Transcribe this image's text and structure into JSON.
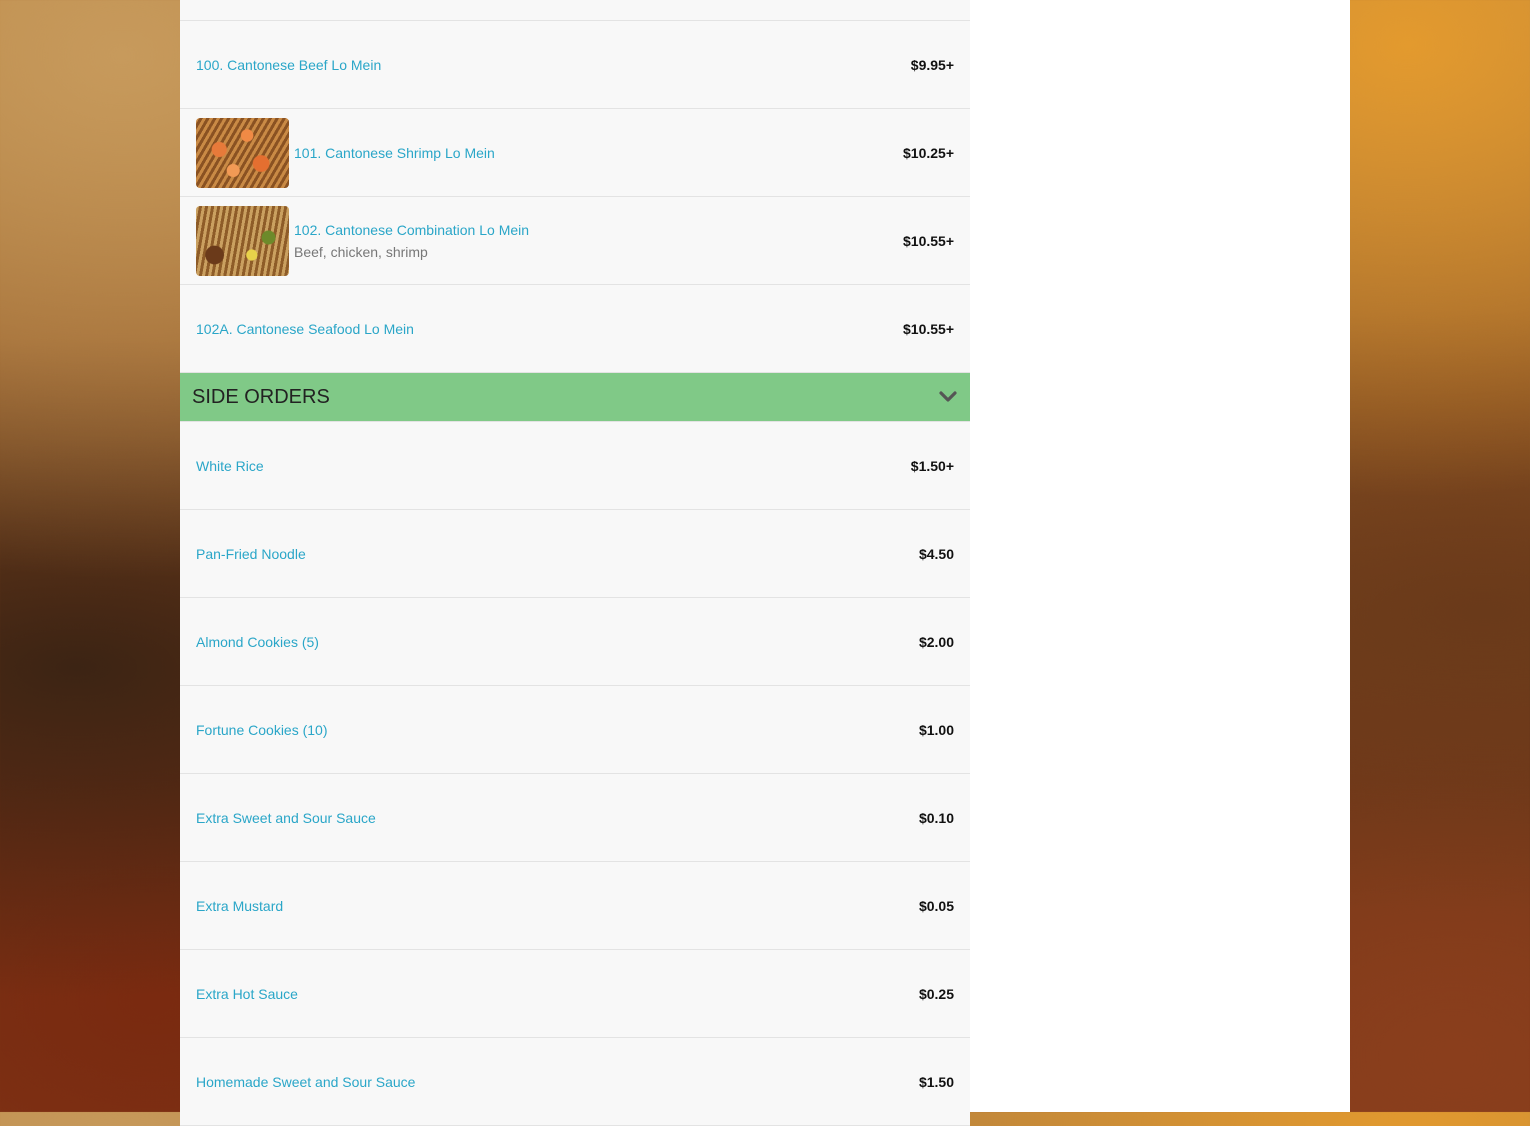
{
  "colors": {
    "accent": "#2aa6c8",
    "section_header_bg": "#80c987"
  },
  "lo_mein_items": [
    {
      "name": "100. Cantonese Beef Lo Mein",
      "price": "$9.95+",
      "description": "",
      "image": ""
    },
    {
      "name": "101. Cantonese Shrimp Lo Mein",
      "price": "$10.25+",
      "description": "",
      "image": "shrimp"
    },
    {
      "name": "102. Cantonese Combination Lo Mein",
      "price": "$10.55+",
      "description": "Beef, chicken, shrimp",
      "image": "combo"
    },
    {
      "name": "102A. Cantonese Seafood Lo Mein",
      "price": "$10.55+",
      "description": "",
      "image": ""
    }
  ],
  "side_orders": {
    "title": "SIDE ORDERS",
    "icon": "chevron-down-icon",
    "items": [
      {
        "name": "White Rice",
        "price": "$1.50+"
      },
      {
        "name": "Pan-Fried Noodle",
        "price": "$4.50"
      },
      {
        "name": "Almond Cookies (5)",
        "price": "$2.00"
      },
      {
        "name": "Fortune Cookies (10)",
        "price": "$1.00"
      },
      {
        "name": "Extra Sweet and Sour Sauce",
        "price": "$0.10"
      },
      {
        "name": "Extra Mustard",
        "price": "$0.05"
      },
      {
        "name": "Extra Hot Sauce",
        "price": "$0.25"
      },
      {
        "name": "Homemade Sweet and Sour Sauce",
        "price": "$1.50"
      }
    ]
  }
}
